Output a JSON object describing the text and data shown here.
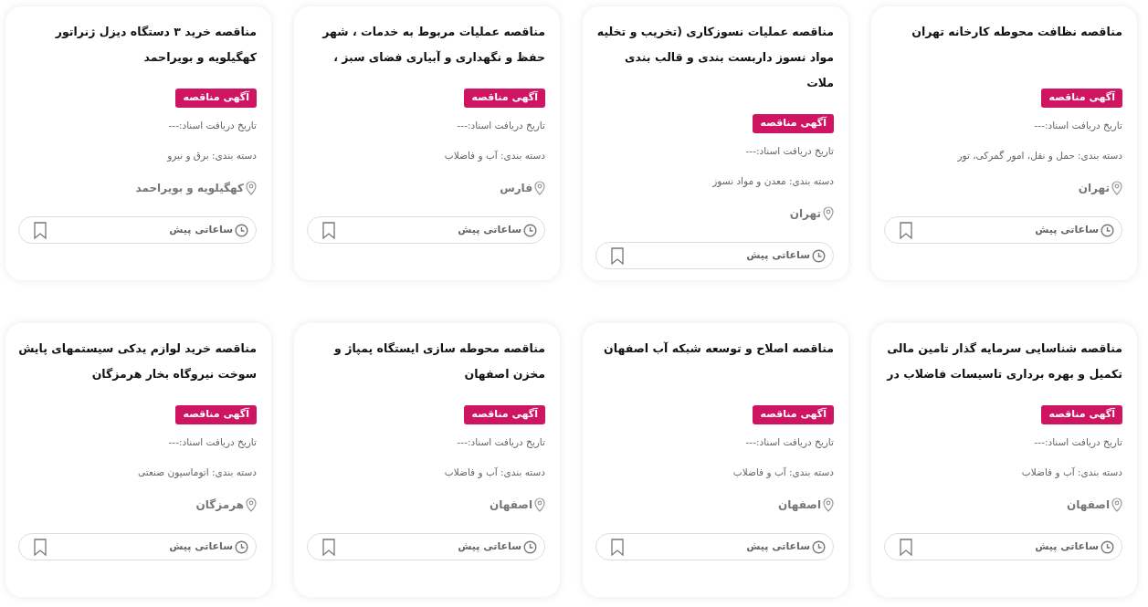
{
  "cards": [
    {
      "title": "مناقصه نظافت محوطه کارخانه تهران",
      "badge": "آگهی مناقصه",
      "date_line": "تاریخ دریافت اسناد:---",
      "category_line": "دسته بندی: حمل و نقل، امور گمرکی، تور",
      "location": "تهران",
      "time": "ساعاتی پیش",
      "bookmarked": false
    },
    {
      "title": "مناقصه عملیات نسوزکاری (تخریب و تخلیه مواد نسوز داربست بندی و قالب بندی ملات",
      "badge": "آگهی مناقصه",
      "date_line": "تاریخ دریافت اسناد:---",
      "category_line": "دسته بندی: معدن و مواد نسوز",
      "location": "تهران",
      "time": "ساعاتی پیش",
      "bookmarked": false
    },
    {
      "title": "مناقصه عملیات مربوط به خدمات ، شهر حفظ و نگهداری و آبیاری فضای سبز ،",
      "badge": "آگهی مناقصه",
      "date_line": "تاریخ دریافت اسناد:---",
      "category_line": "دسته بندی: آب و فاضلاب",
      "location": "فارس",
      "time": "ساعاتی پیش",
      "bookmarked": false
    },
    {
      "title": "مناقصه خرید ۳ دستگاه دیزل ژنراتور کهگیلویه و بویراحمد",
      "badge": "آگهی مناقصه",
      "date_line": "تاریخ دریافت اسناد:---",
      "category_line": "دسته بندی: برق و نیرو",
      "location": "کهگیلویه و بویراحمد",
      "time": "ساعاتی پیش",
      "bookmarked": false
    },
    {
      "title": "مناقصه شناسایی سرمایه گذار تامین مالی تکمیل و بهره برداری تاسیسات فاضلاب در",
      "badge": "آگهی مناقصه",
      "date_line": "تاریخ دریافت اسناد:---",
      "category_line": "دسته بندی: آب و فاضلاب",
      "location": "اصفهان",
      "time": "ساعاتی پیش",
      "bookmarked": false
    },
    {
      "title": "مناقصه اصلاح و توسعه شبکه آب اصفهان",
      "badge": "آگهی مناقصه",
      "date_line": "تاریخ دریافت اسناد:---",
      "category_line": "دسته بندی: آب و فاضلاب",
      "location": "اصفهان",
      "time": "ساعاتی پیش",
      "bookmarked": false
    },
    {
      "title": "مناقصه محوطه سازی ایستگاه پمپاژ و مخزن اصفهان",
      "badge": "آگهی مناقصه",
      "date_line": "تاریخ دریافت اسناد:---",
      "category_line": "دسته بندی: آب و فاضلاب",
      "location": "اصفهان",
      "time": "ساعاتی پیش",
      "bookmarked": false
    },
    {
      "title": "مناقصه خرید لوازم یدکی سیستمهای پایش سوخت نیروگاه بخار هرمزگان",
      "badge": "آگهی مناقصه",
      "date_line": "تاریخ دریافت اسناد:---",
      "category_line": "دسته بندی: اتوماسیون صنعتی",
      "location": "هرمزگان",
      "time": "ساعاتی پیش",
      "bookmarked": false
    }
  ]
}
